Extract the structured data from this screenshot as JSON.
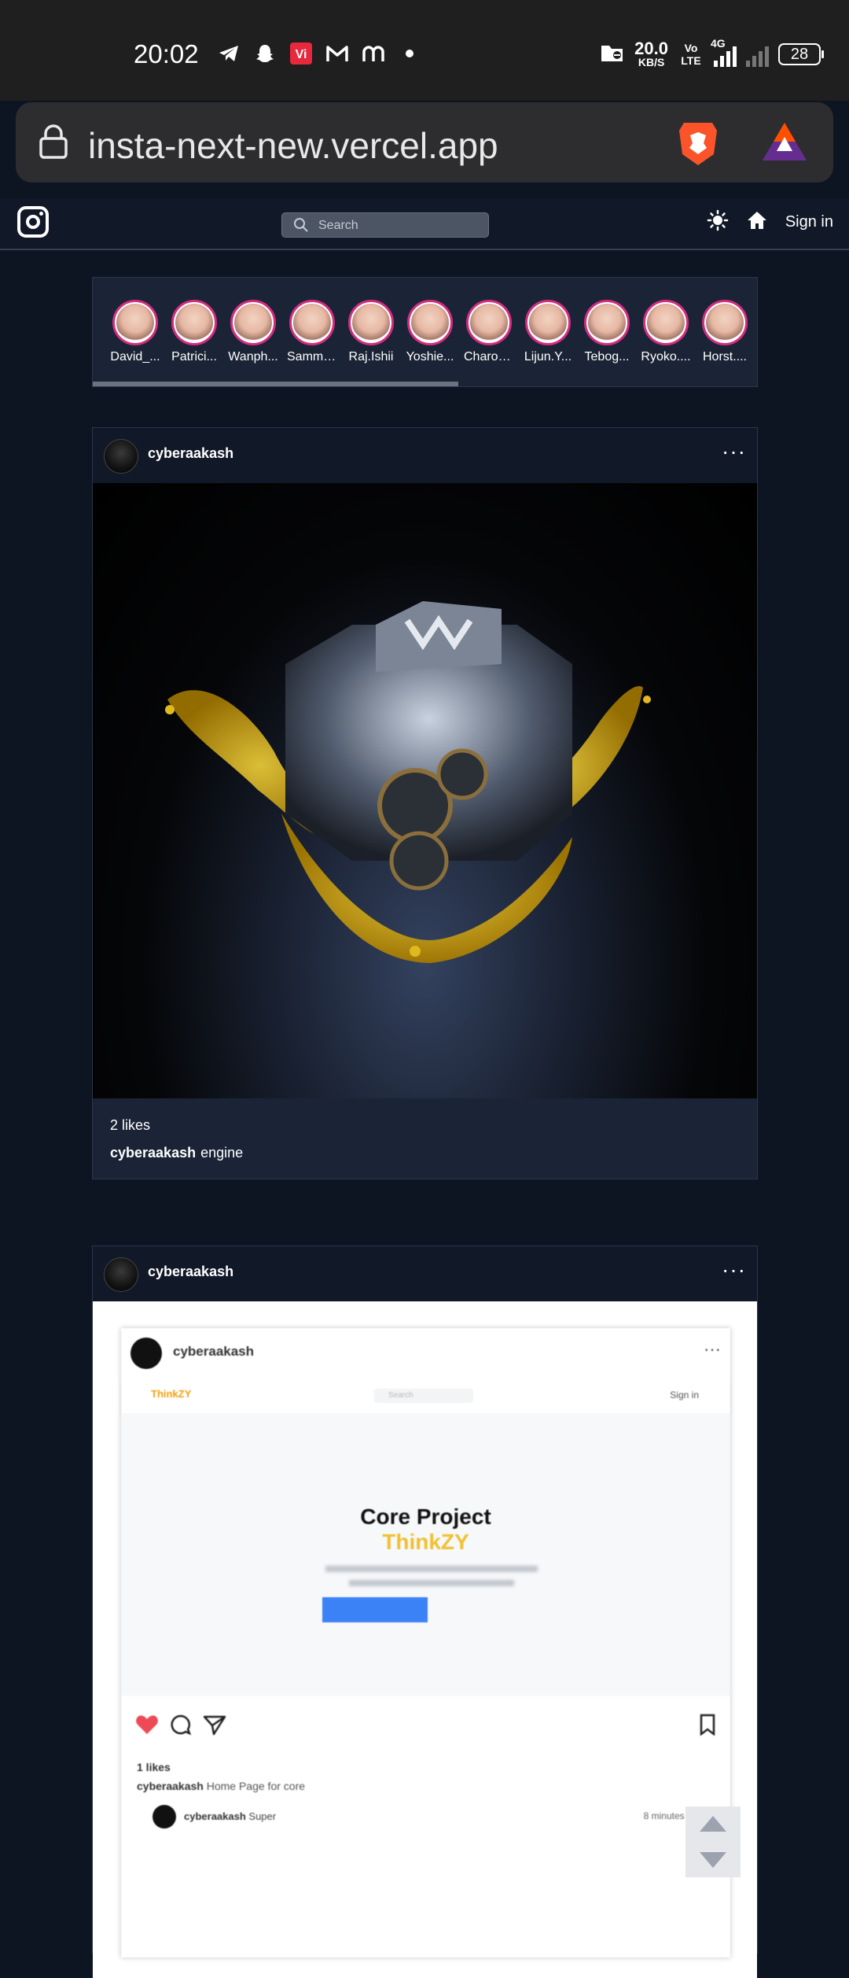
{
  "status_bar": {
    "time": "20:02",
    "net_speed_value": "20.0",
    "net_speed_unit": "KB/S",
    "vo_lte": "Vo LTE",
    "network": "4G",
    "battery": "28"
  },
  "browser": {
    "url": "insta-next-new.vercel.app"
  },
  "appbar": {
    "search_placeholder": "Search",
    "signin_label": "Sign in"
  },
  "stories": [
    {
      "name": "David_..."
    },
    {
      "name": "Patrici..."
    },
    {
      "name": "Wanph..."
    },
    {
      "name": "Sammy..."
    },
    {
      "name": "Raj.Ishii"
    },
    {
      "name": "Yoshie..."
    },
    {
      "name": "Charoe..."
    },
    {
      "name": "Lijun.Y..."
    },
    {
      "name": "Tebog..."
    },
    {
      "name": "Ryoko...."
    },
    {
      "name": "Horst...."
    }
  ],
  "posts": [
    {
      "username": "cyberaakash",
      "menu": "···",
      "likes": "2 likes",
      "caption_user": "cyberaakash",
      "caption_text": "engine"
    },
    {
      "username": "cyberaakash",
      "menu": "···",
      "embedded": {
        "username": "cyberaakash",
        "brand": "ThinkZY",
        "search": "Search",
        "signin": "Sign in",
        "hero_title": "Core Project",
        "hero_subtitle": "ThinkZY",
        "likes": "1 likes",
        "caption_user": "cyberaakash",
        "caption_text": "Home Page for core",
        "comment_user": "cyberaakash",
        "comment_text": "Super",
        "comment_time": "8 minutes ago"
      }
    }
  ]
}
